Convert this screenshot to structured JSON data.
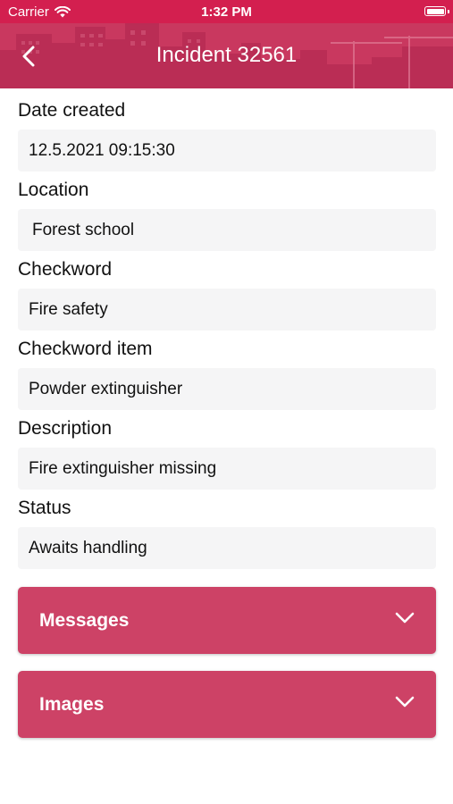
{
  "status_bar": {
    "carrier": "Carrier",
    "time": "1:32 PM",
    "wifi_icon": "wifi-icon",
    "battery_icon": "battery-icon"
  },
  "header": {
    "title": "Incident 32561",
    "back_icon": "chevron-left-icon",
    "background_color": "#c9385f"
  },
  "fields": [
    {
      "label": "Date created",
      "value": "12.5.2021 09:15:30"
    },
    {
      "label": "Location",
      "value": "Forest school"
    },
    {
      "label": "Checkword",
      "value": "Fire safety"
    },
    {
      "label": "Checkword item",
      "value": "Powder extinguisher"
    },
    {
      "label": "Description",
      "value": "Fire extinguisher missing"
    },
    {
      "label": "Status",
      "value": "Awaits handling"
    }
  ],
  "sections": [
    {
      "label": "Messages",
      "icon": "chevron-down-icon"
    },
    {
      "label": "Images",
      "icon": "chevron-down-icon"
    }
  ],
  "colors": {
    "status_bar": "#d31f4f",
    "accent": "#cd4266",
    "field_background": "#f5f5f6"
  }
}
